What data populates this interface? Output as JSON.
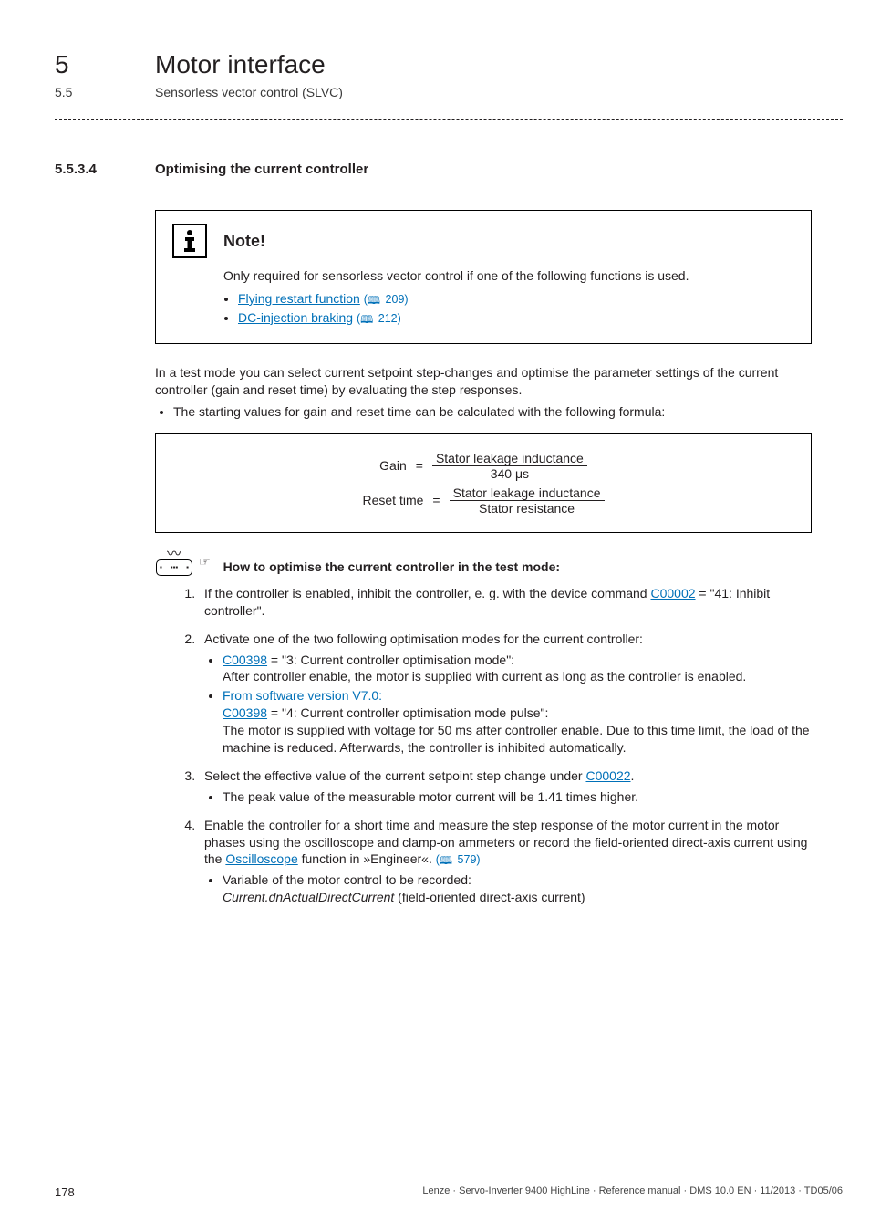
{
  "chapter": {
    "num": "5",
    "title": "Motor interface"
  },
  "section": {
    "num": "5.5",
    "title": "Sensorless vector control (SLVC)"
  },
  "subsub": {
    "num": "5.5.3.4",
    "title": "Optimising the current controller"
  },
  "note": {
    "heading": "Note!",
    "body": "Only required for sensorless vector control if one of the following functions is used.",
    "items": [
      {
        "link": "Flying restart function",
        "ref": "209"
      },
      {
        "link": "DC-injection braking",
        "ref": "212"
      }
    ]
  },
  "paragraphs": {
    "intro": "In a test mode you can select current setpoint step-changes and optimise the parameter settings of the current controller (gain and reset time) by evaluating the step responses.",
    "intro_bullet": "The starting values for gain and reset time can be calculated with the following formula:"
  },
  "formula": {
    "gain_lhs": "Gain",
    "gain_num": "Stator leakage inductance",
    "gain_den": "340 μs",
    "reset_lhs": "Reset time",
    "reset_num": "Stator leakage inductance",
    "reset_den": "Stator resistance",
    "eq": "="
  },
  "howto": {
    "title": "How to optimise the current controller in the test mode:",
    "steps": {
      "s1_pre": "If the controller is enabled, inhibit the controller, e. g. with the device command ",
      "s1_code": "C00002",
      "s1_post": " = \"41: Inhibit controller\".",
      "s2_intro": "Activate one of the two following optimisation modes for the current controller:",
      "s2_a_code": "C00398",
      "s2_a_text": " = \"3: Current controller optimisation mode\":",
      "s2_a_body": "After controller enable, the motor is supplied with current as long as the controller is enabled.",
      "s2_b_since": "From software version V7.0:",
      "s2_b_code": "C00398",
      "s2_b_text": " = \"4: Current controller optimisation mode pulse\":",
      "s2_b_body": "The motor is supplied with voltage for 50 ms after controller enable. Due to this time limit, the load of the machine is reduced. Afterwards, the controller is inhibited automatically.",
      "s3_pre": "Select the effective value of the current setpoint step change under ",
      "s3_code": "C00022",
      "s3_post": ".",
      "s3_bullet": "The peak value of the measurable motor current will be 1.41 times higher.",
      "s4_pre": "Enable the controller for a short time and measure the step response of the motor current in the motor phases using the oscilloscope and clamp-on ammeters or record the field-oriented direct-axis current using the ",
      "s4_link": "Oscilloscope",
      "s4_post": " function in »Engineer«. ",
      "s4_ref": "579",
      "s4_bullet_pre": "Variable of the motor control to be recorded:",
      "s4_bullet_var": "Current.dnActualDirectCurrent",
      "s4_bullet_post": " (field-oriented direct-axis current)"
    }
  },
  "footer": {
    "page": "178",
    "line": "Lenze · Servo-Inverter 9400 HighLine · Reference manual · DMS 10.0 EN · 11/2013 · TD05/06"
  }
}
